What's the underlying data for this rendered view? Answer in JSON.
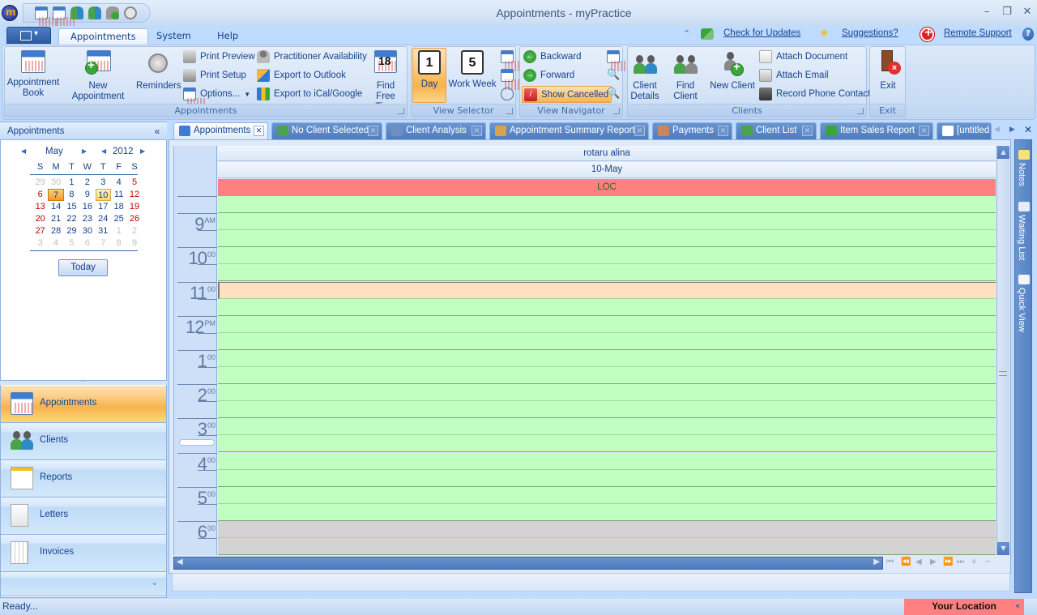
{
  "window": {
    "title": "Appointments - myPractice",
    "controls": {
      "minimize": "–",
      "restore": "❐",
      "close": "✕"
    }
  },
  "quick_access": [
    "appointment-book-icon",
    "new-appointment-icon",
    "find-client-icon",
    "client-details-icon",
    "new-client-icon",
    "reminders-icon"
  ],
  "ribbon": {
    "tabs": [
      {
        "label": "Appointments",
        "active": true
      },
      {
        "label": "System",
        "active": false
      },
      {
        "label": "Help",
        "active": false
      }
    ],
    "top_links": {
      "check_updates": "Check for Updates",
      "suggestions": "Suggestions?",
      "remote_support": "Remote Support",
      "help": "?"
    },
    "groups": {
      "appointments": {
        "label": "Appointments",
        "appointment_book": "Appointment Book",
        "new_appointment": "New Appointment",
        "reminders": "Reminders",
        "print_preview": "Print Preview",
        "print_setup": "Print Setup",
        "options": "Options...",
        "practitioner_availability": "Practitioner Availability",
        "export_outlook": "Export to Outlook",
        "export_ical": "Export to iCal/Google",
        "find_free_time": "Find Free Time"
      },
      "view_selector": {
        "label": "View Selector",
        "day": "Day",
        "work_week": "Work Week",
        "day_icon_num": "1",
        "week_icon_num": "5"
      },
      "view_navigator": {
        "label": "View Navigator",
        "backward": "Backward",
        "forward": "Forward",
        "show_cancelled": "Show Cancelled"
      },
      "clients": {
        "label": "Clients",
        "client_details": "Client Details",
        "find_client": "Find Client",
        "new_client": "New Client",
        "attach_document": "Attach Document",
        "attach_email": "Attach Email",
        "record_phone": "Record Phone Contact"
      },
      "exit": {
        "label": "Exit",
        "exit": "Exit"
      }
    }
  },
  "left_pane": {
    "title": "Appointments",
    "collapse": "«",
    "calendar": {
      "month": "May",
      "year": "2012",
      "weekdays": [
        "S",
        "M",
        "T",
        "W",
        "T",
        "F",
        "S"
      ],
      "weeks": [
        [
          [
            "29",
            "other"
          ],
          [
            "30",
            "other"
          ],
          [
            "1",
            "norm"
          ],
          [
            "2",
            "norm"
          ],
          [
            "3",
            "norm"
          ],
          [
            "4",
            "norm"
          ],
          [
            "5",
            "wkend"
          ]
        ],
        [
          [
            "6",
            "wkend"
          ],
          [
            "7",
            "today"
          ],
          [
            "8",
            "norm"
          ],
          [
            "9",
            "norm"
          ],
          [
            "10",
            "sel"
          ],
          [
            "11",
            "norm"
          ],
          [
            "12",
            "wkend"
          ]
        ],
        [
          [
            "13",
            "wkend"
          ],
          [
            "14",
            "norm"
          ],
          [
            "15",
            "norm"
          ],
          [
            "16",
            "norm"
          ],
          [
            "17",
            "norm"
          ],
          [
            "18",
            "norm"
          ],
          [
            "19",
            "wkend"
          ]
        ],
        [
          [
            "20",
            "wkend"
          ],
          [
            "21",
            "norm"
          ],
          [
            "22",
            "norm"
          ],
          [
            "23",
            "norm"
          ],
          [
            "24",
            "norm"
          ],
          [
            "25",
            "norm"
          ],
          [
            "26",
            "wkend"
          ]
        ],
        [
          [
            "27",
            "wkend"
          ],
          [
            "28",
            "norm"
          ],
          [
            "29",
            "norm"
          ],
          [
            "30",
            "norm"
          ],
          [
            "31",
            "norm"
          ],
          [
            "1",
            "other"
          ],
          [
            "2",
            "other"
          ]
        ],
        [
          [
            "3",
            "other"
          ],
          [
            "4",
            "other"
          ],
          [
            "5",
            "other"
          ],
          [
            "6",
            "other"
          ],
          [
            "7",
            "other"
          ],
          [
            "8",
            "other"
          ],
          [
            "9",
            "other"
          ]
        ]
      ],
      "today_button": "Today"
    },
    "nav_items": [
      {
        "label": "Appointments",
        "active": true
      },
      {
        "label": "Clients",
        "active": false
      },
      {
        "label": "Reports",
        "active": false
      },
      {
        "label": "Letters",
        "active": false
      },
      {
        "label": "Invoices",
        "active": false
      }
    ]
  },
  "doc_tabs": [
    {
      "label": "Appointments",
      "active": true
    },
    {
      "label": "No Client Selected",
      "active": false
    },
    {
      "label": "Client Analysis",
      "active": false
    },
    {
      "label": "Appointment Summary Report",
      "active": false
    },
    {
      "label": "Payments",
      "active": false
    },
    {
      "label": "Client List",
      "active": false
    },
    {
      "label": "Item Sales Report",
      "active": false
    },
    {
      "label": "[untitled",
      "active": false
    }
  ],
  "scheduler": {
    "resource": "rotaru alina",
    "date": "10-May",
    "location_band": "LOC",
    "hours": [
      {
        "h": "9",
        "s": "AM"
      },
      {
        "h": "10",
        "s": "00"
      },
      {
        "h": "11",
        "s": "00"
      },
      {
        "h": "12",
        "s": "PM"
      },
      {
        "h": "1",
        "s": "00"
      },
      {
        "h": "2",
        "s": "00"
      },
      {
        "h": "3",
        "s": "00"
      },
      {
        "h": "4",
        "s": "00"
      },
      {
        "h": "5",
        "s": "00"
      },
      {
        "h": "6",
        "s": "00"
      }
    ],
    "colors": {
      "available": "#c0ffc0",
      "selected": "#ffe0c0",
      "unavailable": "#d3d3d3",
      "location": "#ff8080"
    },
    "nav_buttons": [
      "⏮",
      "⏪",
      "◀",
      "▶",
      "⏩",
      "⏭",
      "+",
      "−"
    ]
  },
  "side_panels": [
    "Notes",
    "Waiting List",
    "Quick View"
  ],
  "status": {
    "text": "Ready...",
    "location": "Your Location"
  }
}
